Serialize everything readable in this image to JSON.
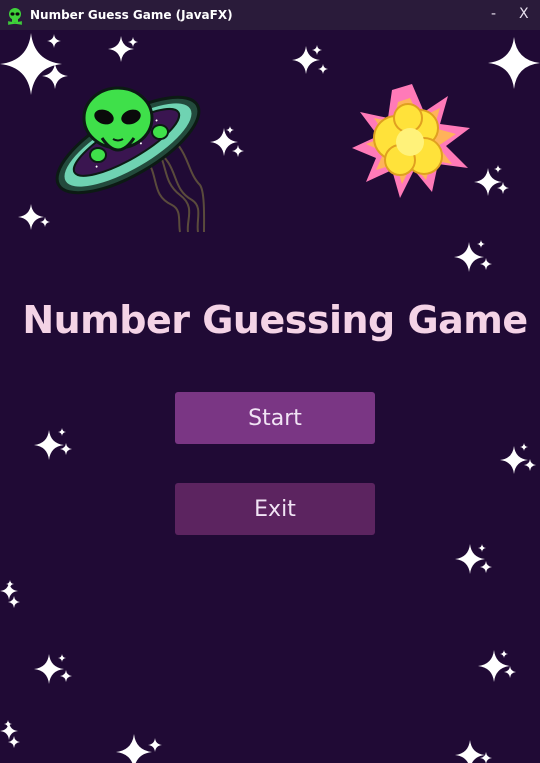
{
  "window": {
    "title": "Number Guess Game (JavaFX)",
    "minimize_label": "-",
    "close_label": "X",
    "icon": "alien-skull-icon"
  },
  "main": {
    "heading": "Number Guessing Game",
    "start_label": "Start",
    "exit_label": "Exit"
  },
  "decorations": {
    "alien_ufo": "alien-ufo-illustration",
    "explosion": "explosion-illustration",
    "stars": "sparkle-star-icon"
  },
  "colors": {
    "background": "#200a35",
    "titlebar": "#2a1b3a",
    "heading": "#f4d3e6",
    "start_button": "#7a3684",
    "exit_button": "#5c2460"
  }
}
